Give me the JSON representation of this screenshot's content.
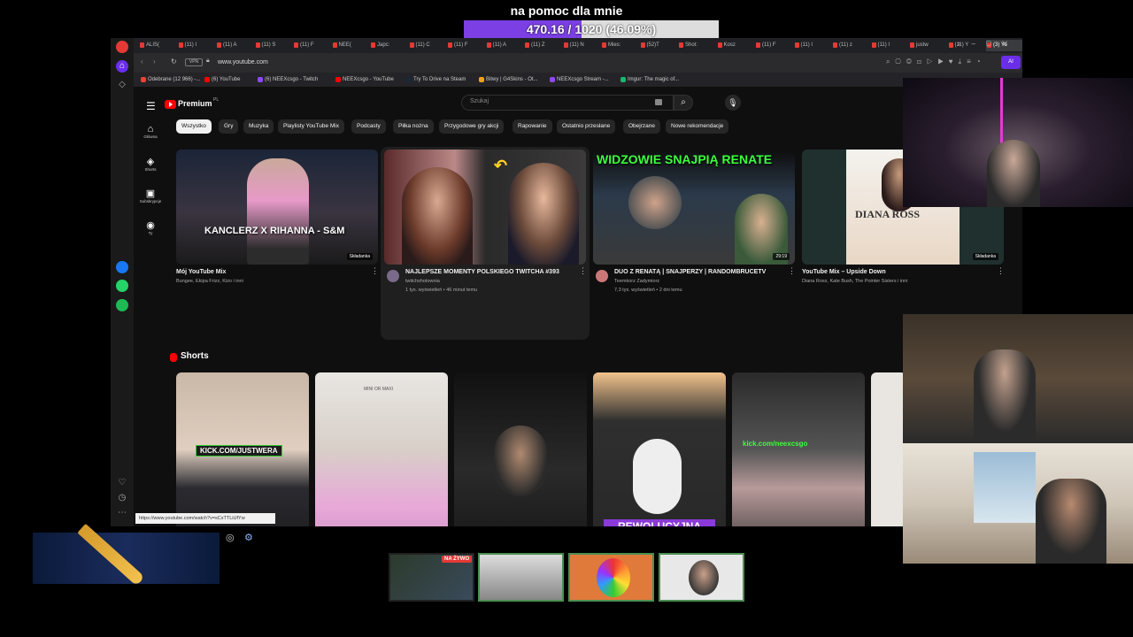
{
  "overlay": {
    "goal_title": "na pomoc dla mnie",
    "goal_text": "470.16 / 1020 (46.09%)",
    "goal_progress": 0.4609,
    "goal_color": "#7b3fe4",
    "live_badge": "NA ŻYWO"
  },
  "browser": {
    "tabs": [
      "ALIS(",
      "(11) I",
      "(11) A",
      "(11) S",
      "(11) F",
      "NEE(",
      "Japc:",
      "(11) C",
      "(11) F",
      "(11) A",
      "(11) Z",
      "(11) N",
      "Mies:",
      "(52)T",
      "Shot:",
      "Kosz",
      "(11) F",
      "(11) I",
      "(11) z",
      "(11) I",
      "justw",
      "(11) Y",
      "(3) Yo"
    ],
    "url": "www.youtube.com",
    "bookmarks": [
      "Odebrane (12 966) -...",
      "(6) YouTube",
      "(6) NEEXcsgo - Twitch",
      "NEEXcsgo - YouTube",
      "Try To Drive na Steam",
      "Bitwy | G4Skins - Ot...",
      "NEEXcsgo Stream -...",
      "Imgur: The magic of..."
    ],
    "status_url": "https://www.youtube.com/watch?v=sCxTTLiUfYw"
  },
  "youtube": {
    "logo": "Premium",
    "logo_country": "PL",
    "search_placeholder": "Szukaj",
    "guide": [
      {
        "icon": "home-icon",
        "label": "Główna"
      },
      {
        "icon": "shorts-icon",
        "label": "Shorts"
      },
      {
        "icon": "subscriptions-icon",
        "label": "Subskrypcje"
      },
      {
        "icon": "you-icon",
        "label": "Ty"
      }
    ],
    "chips": [
      "Wszystko",
      "Gry",
      "Muzyka",
      "Playlisty YouTube Mix",
      "Podcasty",
      "Piłka nożna",
      "Przygodowe gry akcji",
      "Rapowanie",
      "Ostatnio przesłane",
      "Obejrzane",
      "Nowe rekomendacje"
    ],
    "videos": [
      {
        "thumb_text": "KANCLERZ X RIHANNA - S&M",
        "badge": "Składanka",
        "title": "Mój YouTube Mix",
        "meta": "Bungee, Ekipa Frizz, Kizo i inni",
        "stats": ""
      },
      {
        "thumb_text": "",
        "badge": "",
        "title": "NAJLEPSZE MOMENTY POLSKIEGO TWITCHA #393",
        "meta": "twitchshotownia",
        "stats": "1 tys. wyświetleń • 46 minut temu"
      },
      {
        "thumb_text": "WIDZOWIE SNAJPIĄ RENATE",
        "badge": "29:19",
        "title": "DUO Z RENATĄ | SNAJPERZY | RANDOMBRUCETV",
        "meta": "Teemkorz Zadymiorz",
        "stats": "7,3 tys. wyświetleń • 2 dni temu"
      },
      {
        "thumb_text": "DIANA ROSS",
        "badge": "Składanka",
        "title": "YouTube Mix – Upside Down",
        "meta": "Diana Ross, Kate Bush, The Pointer Sisters i inni",
        "stats": ""
      }
    ],
    "shorts_heading": "Shorts",
    "shorts": [
      {
        "overlay_text": "KICK.COM/JUSTWERA"
      },
      {
        "overlay_text": "MINI OR MAXI"
      },
      {
        "overlay_text": ""
      },
      {
        "overlay_text": "REWOLUCYJNA MYSZKA"
      },
      {
        "overlay_text": "kick.com/neexcsgo"
      }
    ]
  }
}
